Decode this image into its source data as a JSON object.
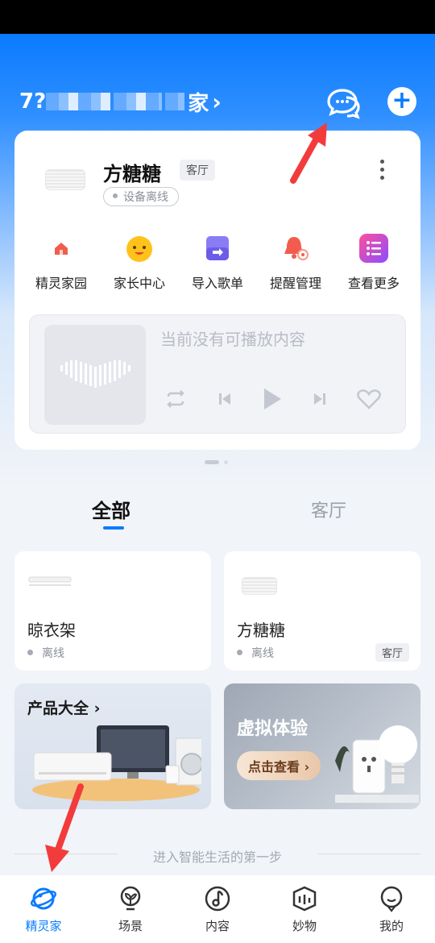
{
  "header": {
    "home_name_visible": "家",
    "home_name_prefix": "7?",
    "chevron": "›"
  },
  "device_card": {
    "name": "方糖糖",
    "room": "客厅",
    "status": "设备离线",
    "quick_actions": [
      {
        "label": "精灵家园",
        "icon": "home-icon"
      },
      {
        "label": "家长中心",
        "icon": "kid-face-icon"
      },
      {
        "label": "导入歌单",
        "icon": "import-playlist-icon"
      },
      {
        "label": "提醒管理",
        "icon": "bell-icon"
      },
      {
        "label": "查看更多",
        "icon": "more-list-icon"
      }
    ],
    "player": {
      "placeholder": "当前没有可播放内容"
    }
  },
  "tabs": {
    "all": "全部",
    "room": "客厅"
  },
  "devices": [
    {
      "name": "晾衣架",
      "status": "离线",
      "room": ""
    },
    {
      "name": "方糖糖",
      "status": "离线",
      "room": "客厅"
    }
  ],
  "promos": {
    "left_title": "产品大全 ›",
    "right_title": "虚拟体验",
    "right_cta": "点击查看 ›"
  },
  "footer": {
    "tagline": "进入智能生活的第一步"
  },
  "bottom_nav": [
    {
      "label": "精灵家",
      "icon": "planet-icon",
      "active": true
    },
    {
      "label": "场景",
      "icon": "bulb-leaf-icon",
      "active": false
    },
    {
      "label": "内容",
      "icon": "music-note-icon",
      "active": false
    },
    {
      "label": "妙物",
      "icon": "box-icon",
      "active": false
    },
    {
      "label": "我的",
      "icon": "face-icon",
      "active": false
    }
  ],
  "colors": {
    "accent": "#0a7bff",
    "annotation": "#f23c3c"
  }
}
